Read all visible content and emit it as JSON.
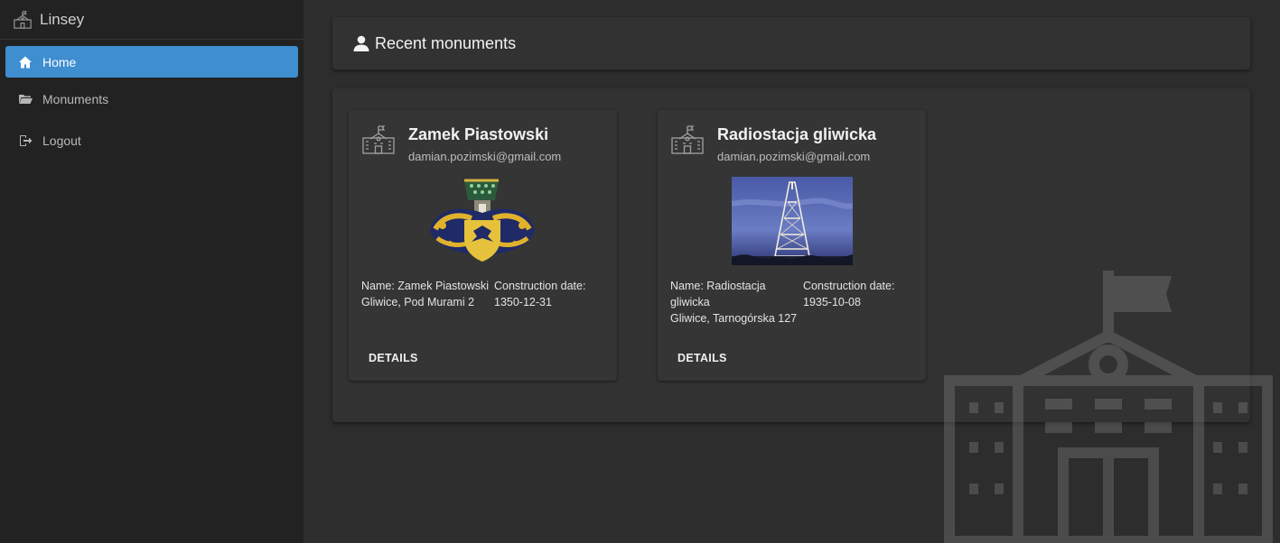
{
  "brand": {
    "name": "Linsey",
    "icon": "school-building-icon"
  },
  "sidebar": {
    "items": [
      {
        "label": "Home",
        "icon": "home-icon",
        "active": true
      },
      {
        "label": "Monuments",
        "icon": "folder-open-icon",
        "active": false
      },
      {
        "label": "Logout",
        "icon": "sign-out-icon",
        "active": false
      }
    ]
  },
  "header": {
    "title": "Recent monuments",
    "icon": "user-icon"
  },
  "cards": [
    {
      "title": "Zamek Piastowski",
      "email": "damian.pozimski@gmail.com",
      "name_line": "Name: Zamek Piastowski",
      "address": "Gliwice, Pod Murami 2",
      "date_label": "Construction date:",
      "date": "1350-12-31",
      "details": "DETAILS",
      "image": "coat-of-arms-image"
    },
    {
      "title": "Radiostacja gliwicka",
      "email": "damian.pozimski@gmail.com",
      "name_line": "Name: Radiostacja gliwicka",
      "address": "Gliwice, Tarnogórska 127",
      "date_label": "Construction date:",
      "date": "1935-10-08",
      "details": "DETAILS",
      "image": "radio-tower-photo"
    }
  ],
  "colors": {
    "accent": "#3e8ed0",
    "sidebar_bg": "#222222",
    "page_bg": "#2d2d2d",
    "panel_bg": "#323232"
  }
}
